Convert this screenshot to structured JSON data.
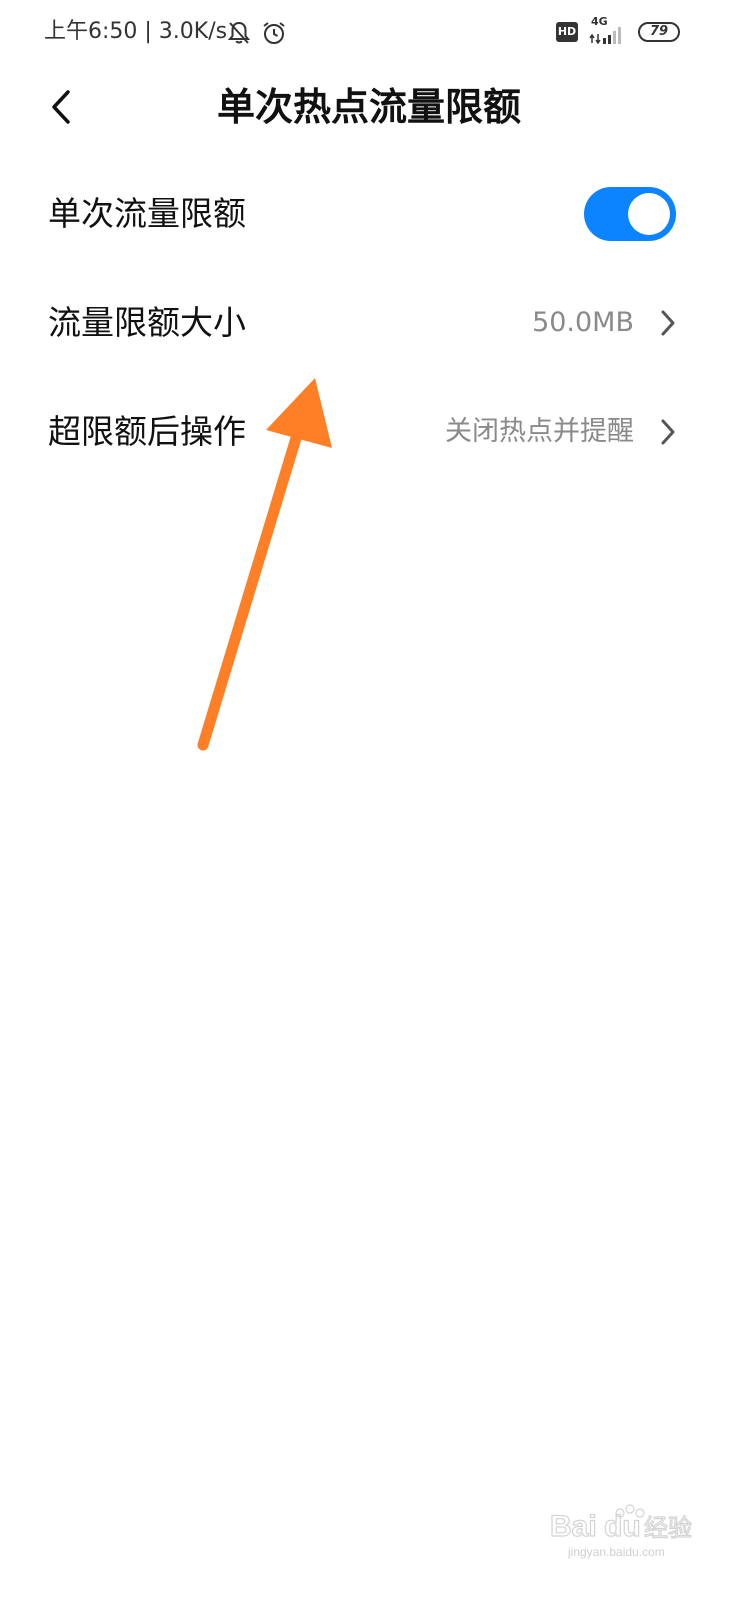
{
  "status_bar": {
    "text": "上午6:50 | 3.0K/s",
    "network": "4G",
    "battery": "79",
    "hd_badge": "HD",
    "icons": [
      "mute-bell-icon",
      "alarm-clock-icon",
      "hd-icon",
      "signal-icon",
      "battery-icon"
    ]
  },
  "header": {
    "title": "单次热点流量限额",
    "back_icon": "chevron-left-icon"
  },
  "rows": [
    {
      "label": "单次流量限额",
      "control": "toggle",
      "toggle_on": true
    },
    {
      "label": "流量限额大小",
      "value": "50.0MB"
    },
    {
      "label": "超限额后操作",
      "value": "关闭热点并提醒"
    }
  ],
  "colors": {
    "accent": "#0d84ff",
    "annotation_arrow": "#ff7f27",
    "secondary_text": "#8a8a8a"
  },
  "watermark": {
    "brand": "Baidu经验",
    "url": "jingyan.baidu.com"
  }
}
